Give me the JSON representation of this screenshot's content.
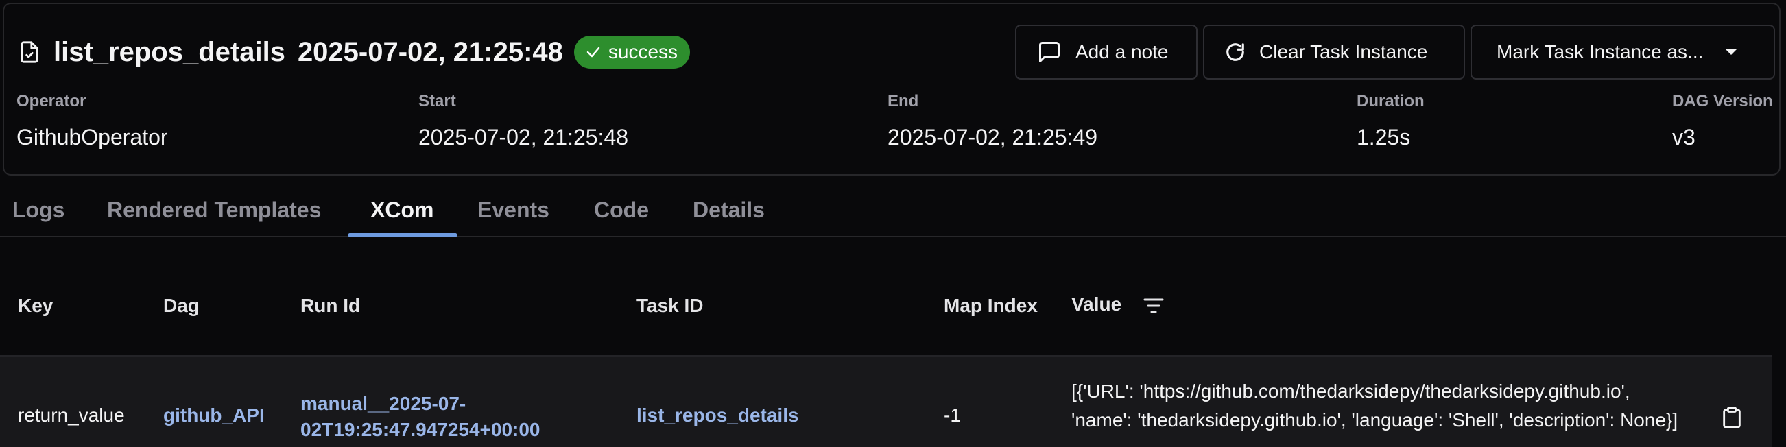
{
  "header": {
    "task_name": "list_repos_details",
    "run_date": "2025-07-02, 21:25:48",
    "state_badge": "success",
    "buttons": {
      "add_note": "Add a note",
      "clear": "Clear Task Instance",
      "mark": "Mark Task Instance as..."
    },
    "meta": {
      "operator_label": "Operator",
      "operator_value": "GithubOperator",
      "start_label": "Start",
      "start_value": "2025-07-02, 21:25:48",
      "end_label": "End",
      "end_value": "2025-07-02, 21:25:49",
      "duration_label": "Duration",
      "duration_value": "1.25s",
      "version_label": "DAG Version",
      "version_value": "v3"
    }
  },
  "tabs": [
    {
      "label": "Logs"
    },
    {
      "label": "Rendered Templates"
    },
    {
      "label": "XCom"
    },
    {
      "label": "Events"
    },
    {
      "label": "Code"
    },
    {
      "label": "Details"
    }
  ],
  "active_tab": "XCom",
  "table": {
    "columns": [
      "Key",
      "Dag",
      "Run Id",
      "Task ID",
      "Map Index",
      "Value"
    ],
    "rows": [
      {
        "key": "return_value",
        "dag": "github_API",
        "run_id_line1": "manual__2025-07-",
        "run_id_line2": "02T19:25:47.947254+00:00",
        "task_id": "list_repos_details",
        "map_index": "-1",
        "value": "[{'URL': 'https://github.com/thedarksidepy/thedarksidepy.github.io', 'name': 'thedarksidepy.github.io', 'language': 'Shell', 'description': None}]"
      }
    ]
  },
  "colors": {
    "success": "#2d8e2d",
    "link": "#9ab6e8",
    "tab_underline": "#6e9be0",
    "background": "#09090b"
  }
}
